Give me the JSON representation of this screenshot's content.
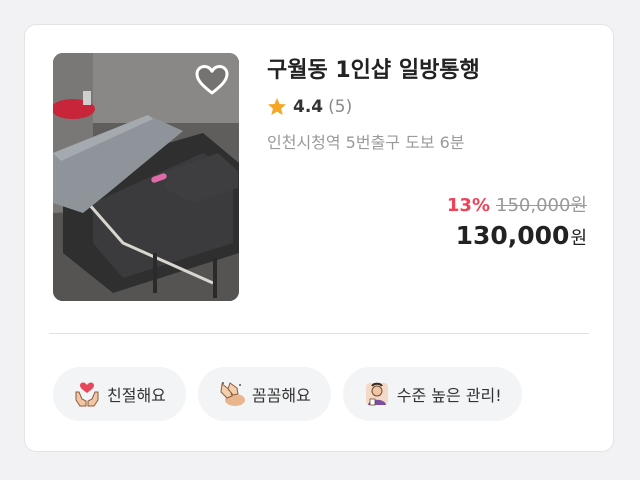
{
  "listing": {
    "title": "구월동 1인샵 일방통행",
    "rating": "4.4",
    "review_count": "(5)",
    "location": "인천시청역 5번출구 도보 6분",
    "discount": "13%",
    "original_price": "150,000원",
    "price": "130,000",
    "price_unit": "원",
    "favorite_icon": "heart-outline-icon",
    "rating_icon": "star-icon"
  },
  "tags": [
    {
      "label": "친절해요",
      "icon": "caring-hands-heart-icon"
    },
    {
      "label": "꼼꼼해요",
      "icon": "massage-hands-icon"
    },
    {
      "label": "수준 높은 관리!",
      "icon": "therapist-badge-icon"
    }
  ],
  "colors": {
    "discount": "#f0435a",
    "star": "#f5a623",
    "tag_background": "#f3f4f6"
  }
}
